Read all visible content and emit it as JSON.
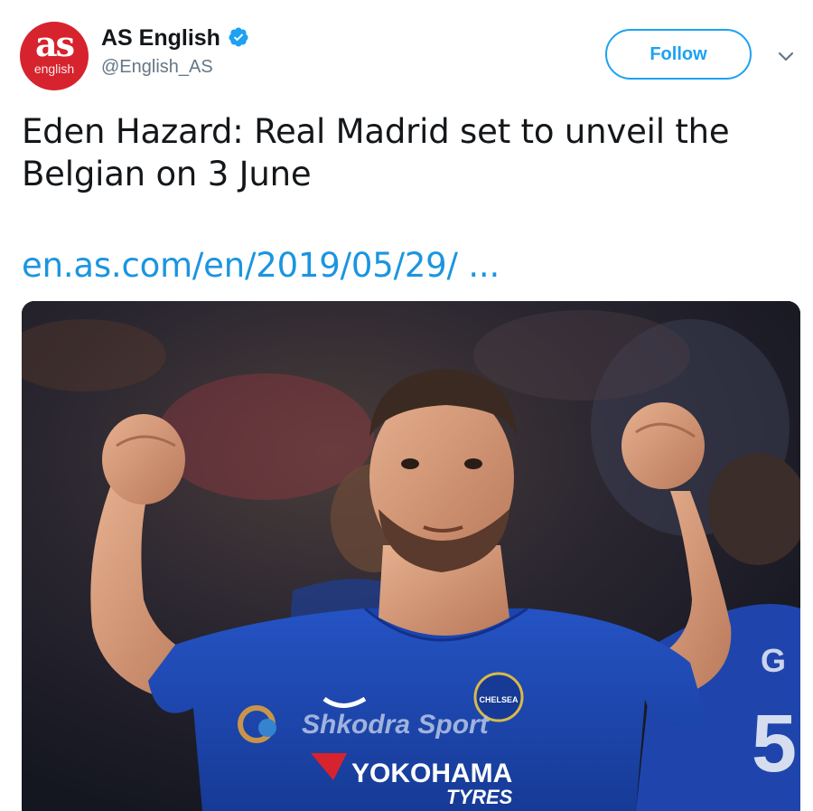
{
  "account": {
    "avatar_text": "as",
    "avatar_subtext": "english",
    "display_name": "AS English",
    "handle": "@English_AS",
    "verified": true
  },
  "actions": {
    "follow_label": "Follow",
    "menu_icon": "chevron-down-icon"
  },
  "tweet": {
    "text": "Eden Hazard: Real Madrid set to unveil the Belgian on 3 June",
    "link": "en.as.com/en/2019/05/29/ ..."
  },
  "media": {
    "watermark": "Shkodra Sport",
    "sponsor": "YOKOHAMA",
    "sponsor_sub": "TYRES",
    "badge": "CHELSEA"
  },
  "colors": {
    "accent": "#1da1f2",
    "link": "#1b95e0",
    "avatar_bg": "#d6232d",
    "jersey": "#1f4bb5"
  }
}
